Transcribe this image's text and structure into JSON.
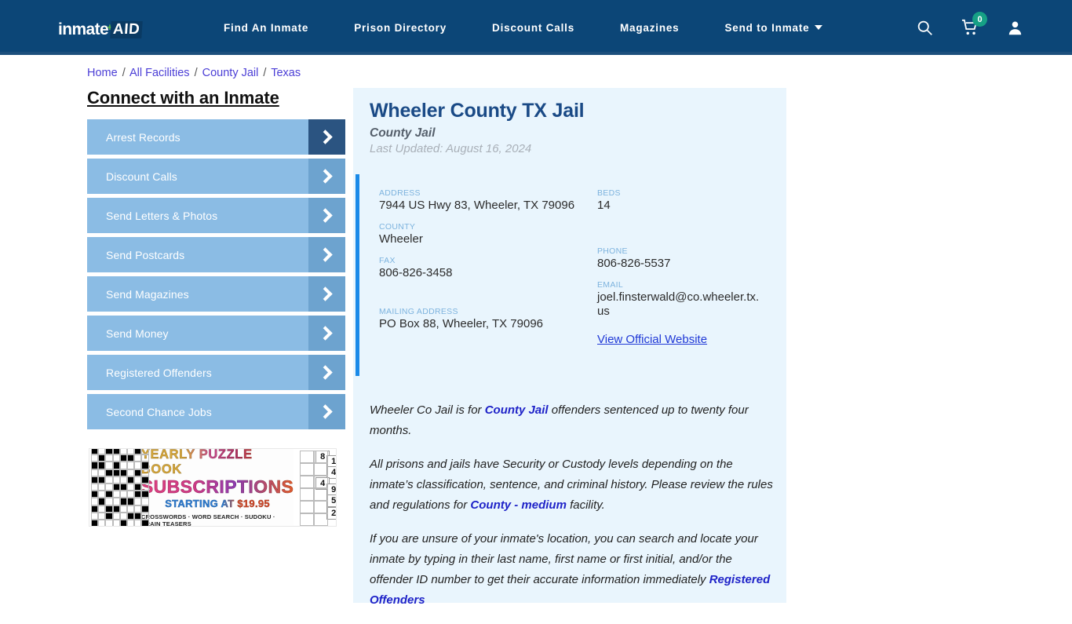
{
  "header": {
    "logo": {
      "part1": "inmate",
      "plus": "+",
      "part2": "AID"
    },
    "nav": [
      {
        "label": "Find An Inmate",
        "dropdown": false
      },
      {
        "label": "Prison Directory",
        "dropdown": false
      },
      {
        "label": "Discount Calls",
        "dropdown": false
      },
      {
        "label": "Magazines",
        "dropdown": false
      },
      {
        "label": "Send to Inmate",
        "dropdown": true
      }
    ],
    "icons": {
      "search": "search-icon",
      "cart": "shopping-cart-icon",
      "cart_count": "0",
      "account": "user-account-icon"
    },
    "colors": {
      "bar": "#0c4677",
      "badge": "#16a085",
      "logo_plus": "#5bbd4a"
    }
  },
  "breadcrumb": {
    "items": [
      "Home",
      "All Facilities",
      "County Jail",
      "Texas"
    ],
    "separator": "/"
  },
  "sidebar": {
    "title": "Connect with an Inmate",
    "items": [
      {
        "label": "Arrest Records",
        "active": true
      },
      {
        "label": "Discount Calls",
        "active": false
      },
      {
        "label": "Send Letters & Photos",
        "active": false
      },
      {
        "label": "Send Postcards",
        "active": false
      },
      {
        "label": "Send Magazines",
        "active": false
      },
      {
        "label": "Send Money",
        "active": false
      },
      {
        "label": "Registered Offenders",
        "active": false
      },
      {
        "label": "Second Chance Jobs",
        "active": false
      }
    ]
  },
  "ad": {
    "line1": "YEARLY PUZZLE BOOK",
    "line2": "SUBSCRIPTIONS",
    "line3": "STARTING AT $19.95",
    "line4": "CROSSWORDS · WORD SEARCH · SUDOKU · BRAIN TEASERS",
    "sudoku_digits": [
      "8",
      "1",
      "4",
      "4",
      "9",
      "5",
      "2"
    ]
  },
  "facility": {
    "title": "Wheeler County TX Jail",
    "subtitle": "County Jail",
    "updated": "Last Updated: August 16, 2024",
    "info_left": [
      {
        "label": "ADDRESS",
        "value": "7944 US Hwy 83, Wheeler, TX 79096"
      },
      {
        "label": "COUNTY",
        "value": "Wheeler"
      },
      {
        "label": "FAX",
        "value": "806-826-3458"
      },
      {
        "label": "MAILING ADDRESS",
        "value": "PO Box 88, Wheeler, TX 79096"
      }
    ],
    "info_right": [
      {
        "label": "BEDS",
        "value": "14"
      },
      {
        "label": "PHONE",
        "value": "806-826-5537"
      },
      {
        "label": "EMAIL",
        "value": "joel.finsterwald@co.wheeler.tx.us"
      }
    ],
    "website_link": "View Official Website",
    "accent_color": "#1b8ae8"
  },
  "body": {
    "p1_a": "Wheeler Co Jail is for ",
    "p1_link": "County Jail",
    "p1_b": " offenders sentenced up to twenty four months.",
    "p2_a": "All prisons and jails have Security or Custody levels depending on the inmate’s classification, sentence, and criminal history. Please review the rules and regulations for ",
    "p2_link": "County - medium",
    "p2_b": " facility.",
    "p3_a": "If you are unsure of your inmate's location, you can search and locate your inmate by typing in their last name, first name or first initial, and/or the offender ID number to get their accurate information immediately ",
    "p3_link": "Registered Offenders"
  }
}
